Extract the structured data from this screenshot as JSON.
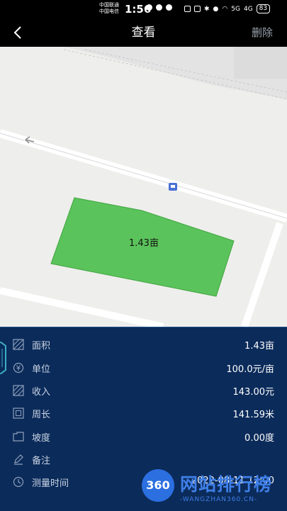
{
  "status_bar": {
    "carrier_1": "中国联通",
    "carrier_2": "中国电信",
    "time": "1:56",
    "battery": "83",
    "network_1": "5G",
    "network_2": "4G"
  },
  "header": {
    "title": "查看",
    "delete_label": "删除"
  },
  "map": {
    "area_label": "1.43亩",
    "colors": {
      "plot_fill": "#5bc35b",
      "background": "#eeeeec",
      "road": "#ffffff"
    }
  },
  "details": {
    "rows": [
      {
        "icon": "area-icon",
        "label": "面积",
        "value": "1.43亩"
      },
      {
        "icon": "currency-icon",
        "label": "单位",
        "value": "100.0元/亩"
      },
      {
        "icon": "income-icon",
        "label": "收入",
        "value": "143.00元"
      },
      {
        "icon": "perimeter-icon",
        "label": "周长",
        "value": "141.59米"
      },
      {
        "icon": "slope-icon",
        "label": "坡度",
        "value": "0.00度"
      },
      {
        "icon": "note-icon",
        "label": "备注",
        "value": ""
      },
      {
        "icon": "clock-icon",
        "label": "测量时间",
        "value": "2022-08-11 12:00"
      }
    ],
    "colors": {
      "panel": "#0b2b5a"
    }
  },
  "watermark": {
    "logo_text": "360",
    "title": "网站排行榜",
    "subtitle": "-WANGZHAN360.CN-"
  }
}
